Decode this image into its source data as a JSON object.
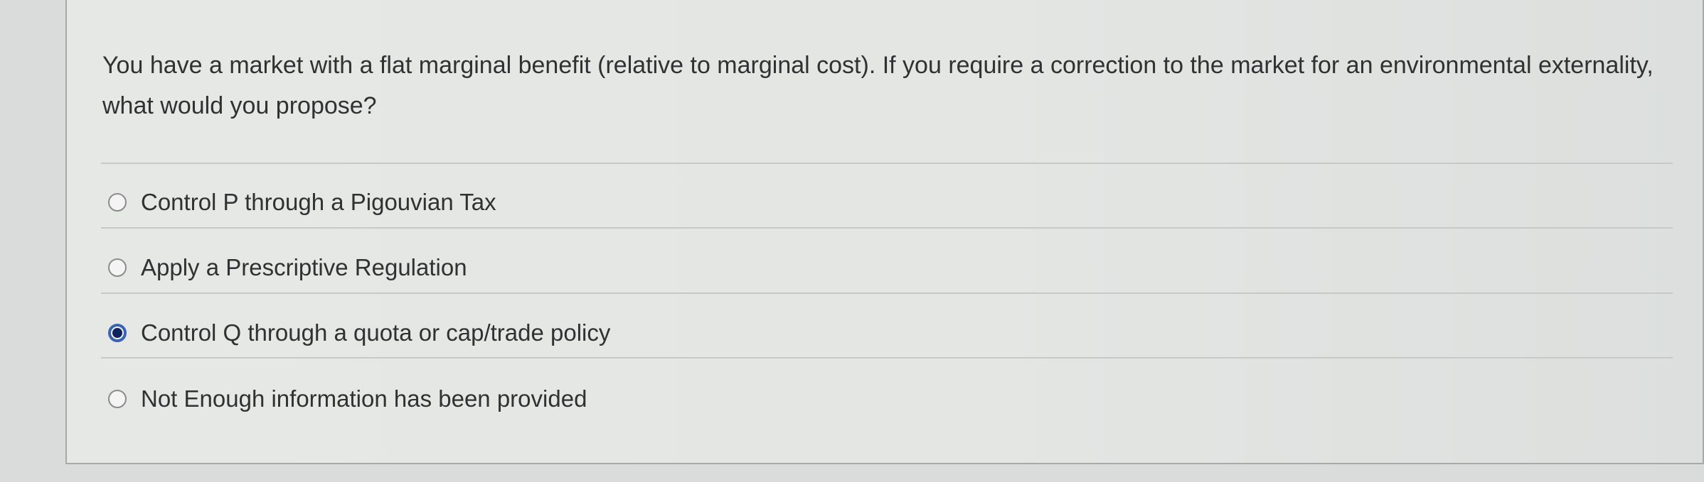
{
  "question": {
    "text": "You have a market with a flat marginal benefit (relative to marginal cost). If you require a correction to the market for an environmental externality, what would you propose?"
  },
  "options": [
    {
      "label": "Control P through a Pigouvian Tax",
      "selected": false
    },
    {
      "label": "Apply a Prescriptive Regulation",
      "selected": false
    },
    {
      "label": "Control Q through a quota or cap/trade policy",
      "selected": true
    },
    {
      "label": "Not Enough information has been provided",
      "selected": false
    }
  ],
  "colors": {
    "accent": "#3a63b0",
    "selected_dot": "#10235e",
    "text": "#2f3132"
  }
}
